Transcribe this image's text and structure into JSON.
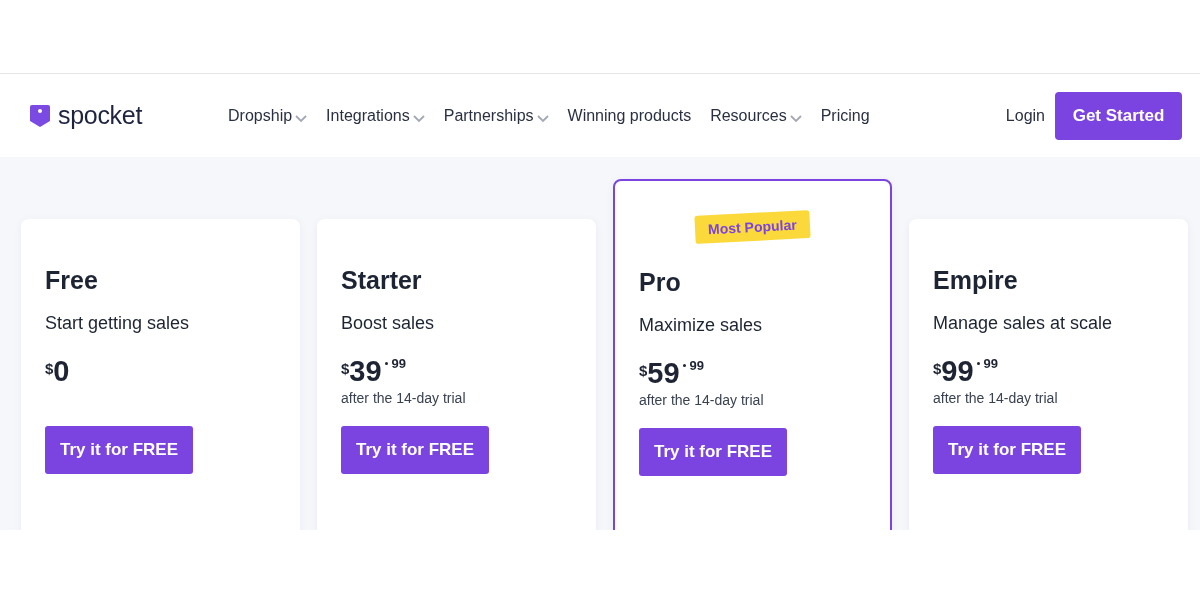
{
  "header": {
    "logo": "spocket",
    "nav": [
      {
        "label": "Dropship",
        "dropdown": true
      },
      {
        "label": "Integrations",
        "dropdown": true
      },
      {
        "label": "Partnerships",
        "dropdown": true
      },
      {
        "label": "Winning products",
        "dropdown": false
      },
      {
        "label": "Resources",
        "dropdown": true
      },
      {
        "label": "Pricing",
        "dropdown": false
      }
    ],
    "login": "Login",
    "cta": "Get Started"
  },
  "plans": [
    {
      "name": "Free",
      "tagline": "Start getting sales",
      "currency": "$",
      "amount": "0",
      "popular": false,
      "button": "Try it for FREE"
    },
    {
      "name": "Starter",
      "tagline": "Boost sales",
      "currency": "$",
      "amount": "39",
      "cents": "99",
      "note": "after the 14-day trial",
      "popular": false,
      "button": "Try it for FREE"
    },
    {
      "name": "Pro",
      "badge": "Most Popular",
      "tagline": "Maximize sales",
      "currency": "$",
      "amount": "59",
      "cents": "99",
      "note": "after the 14-day trial",
      "popular": true,
      "button": "Try it for FREE"
    },
    {
      "name": "Empire",
      "tagline": "Manage sales at scale",
      "currency": "$",
      "amount": "99",
      "cents": "99",
      "note": "after the 14-day trial",
      "popular": false,
      "button": "Try it for FREE"
    }
  ]
}
